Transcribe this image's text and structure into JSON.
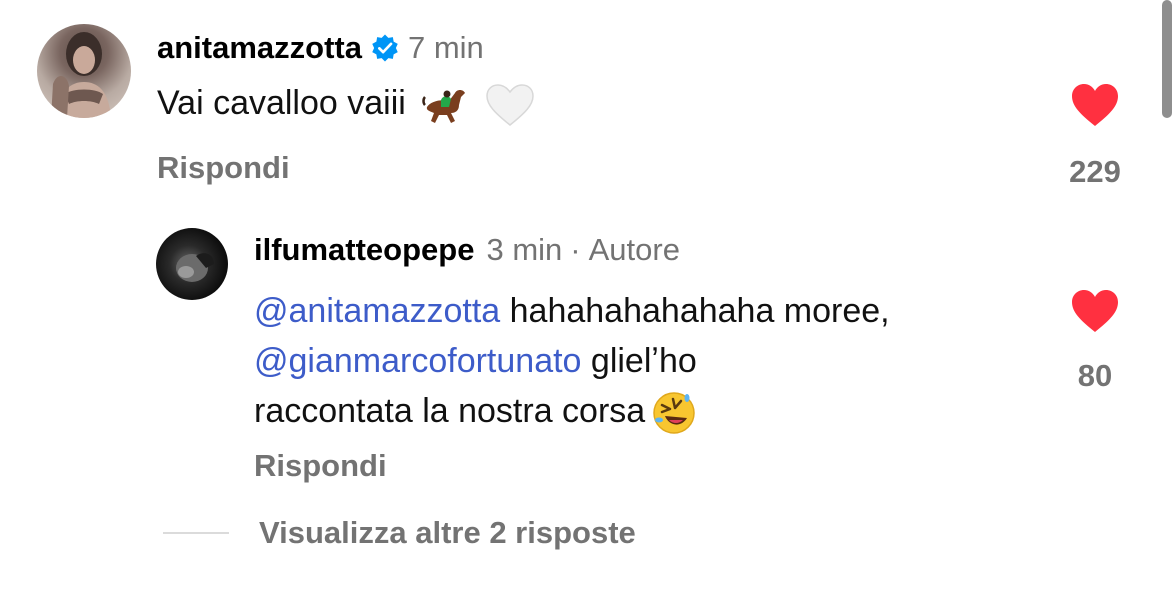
{
  "comments": [
    {
      "username": "anitamazzotta",
      "verified": true,
      "time": "7 min",
      "text": "Vai cavalloo vaiii",
      "emojis": [
        "horse-racing-emoji",
        "white-heart-emoji"
      ],
      "reply_label": "Rispondi",
      "liked": true,
      "like_count": "229"
    }
  ],
  "replies": [
    {
      "username": "ilfumatteopepe",
      "time": "3 min",
      "separator": "·",
      "role": "Autore",
      "mention1": "@anitamazzotta",
      "text1": " hahahahahahaha moree,",
      "mention2": "@gianmarcofortunato",
      "text2": " glielʼho",
      "text3": "raccontata la nostra corsa",
      "emoji": "rolling-on-floor-laughing-emoji",
      "reply_label": "Rispondi",
      "liked": true,
      "like_count": "80"
    }
  ],
  "view_more_label": "Visualizza altre 2 risposte",
  "colors": {
    "text": "#000000",
    "secondary": "#737373",
    "mention": "#3d5cc9",
    "like_red": "#ff3040",
    "verified_blue": "#0095f6"
  }
}
